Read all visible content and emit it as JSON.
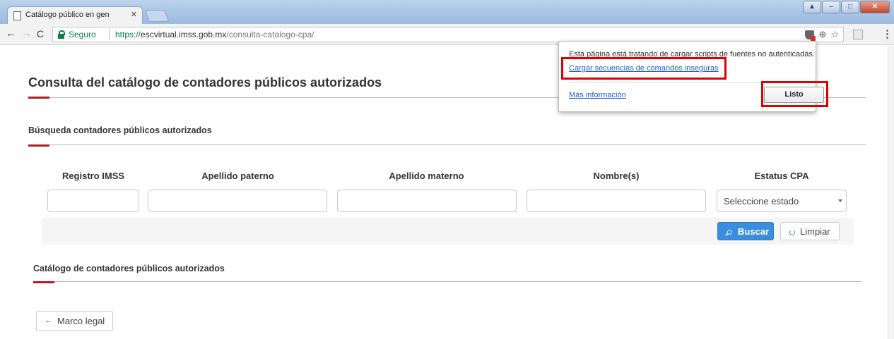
{
  "browser": {
    "tab_title": "Catálogo público en gen",
    "tab_close": "✕",
    "security_label": "Seguro",
    "url_protocol": "https://",
    "url_host": "escvirtual.imss.gob.mx",
    "url_path": "/consulta-catalogo-cpa/",
    "icons": [
      "back-icon",
      "forward-icon",
      "reload-icon",
      "lock-icon",
      "blocked-script-shield-icon",
      "zoom-icon",
      "star-icon",
      "extension-icon",
      "menu-icon"
    ]
  },
  "page": {
    "title": "Consulta del catálogo de contadores públicos autorizados",
    "search_section_title": "Búsqueda contadores públicos autorizados",
    "columns": [
      {
        "label": "Registro IMSS"
      },
      {
        "label": "Apellido paterno"
      },
      {
        "label": "Apellido materno"
      },
      {
        "label": "Nombre(s)"
      },
      {
        "label": "Estatus CPA"
      }
    ],
    "inputs": {
      "registro_imss": "",
      "apellido_paterno": "",
      "apellido_materno": "",
      "nombres": ""
    },
    "status_select_value": "Seleccione estado",
    "buscar_label": "Buscar",
    "limpiar_label": "Limpiar",
    "catalog_section_title": "Catálogo de contadores públicos autorizados",
    "marco_legal_label": "Marco legal",
    "accent_color": "#b31b23",
    "primary_color": "#3b8de0"
  },
  "popup": {
    "message": "Esta página está tratando de cargar scripts de fuentes no autenticadas.",
    "load_unsafe_link": "Cargar secuencias de comandos inseguras",
    "more_info_link": "Más información",
    "done_button": "Listo",
    "highlight_color": "#e00000"
  }
}
